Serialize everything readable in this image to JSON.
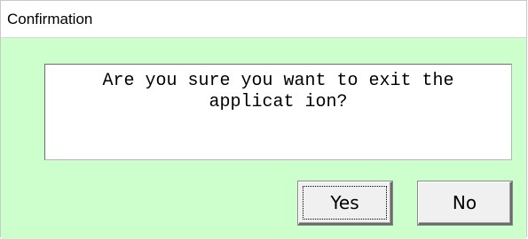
{
  "window": {
    "title": "Confirmation"
  },
  "message": {
    "line1": "Are you sure you want to exit the",
    "line2": "applicat ion?"
  },
  "buttons": {
    "yes_label": "Yes",
    "no_label": "No"
  },
  "colors": {
    "client_background": "#ccffcc",
    "message_background": "#ffffff",
    "button_face": "#f0f0f0"
  }
}
